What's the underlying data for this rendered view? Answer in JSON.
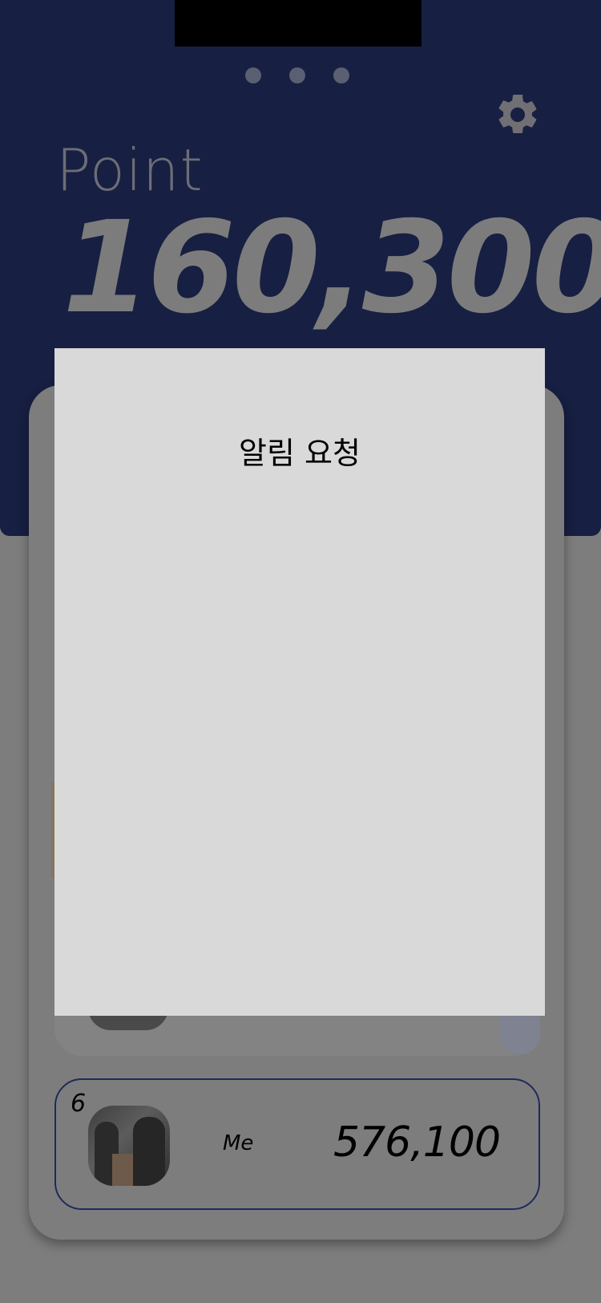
{
  "header": {
    "page_dots": [
      "dot-1",
      "dot-2",
      "dot-3"
    ],
    "settings_icon": "gear-icon",
    "point_label": "Point",
    "point_value": "160,300"
  },
  "ranking": {
    "me": {
      "rank": "6",
      "name": "Me",
      "points": "576,100"
    }
  },
  "modal": {
    "title": "알림 요청"
  },
  "colors": {
    "header_bg": "#171f42",
    "overlay": "#7d7d7d",
    "modal_bg": "#d9d9d9",
    "me_border": "#1e2a5e"
  }
}
